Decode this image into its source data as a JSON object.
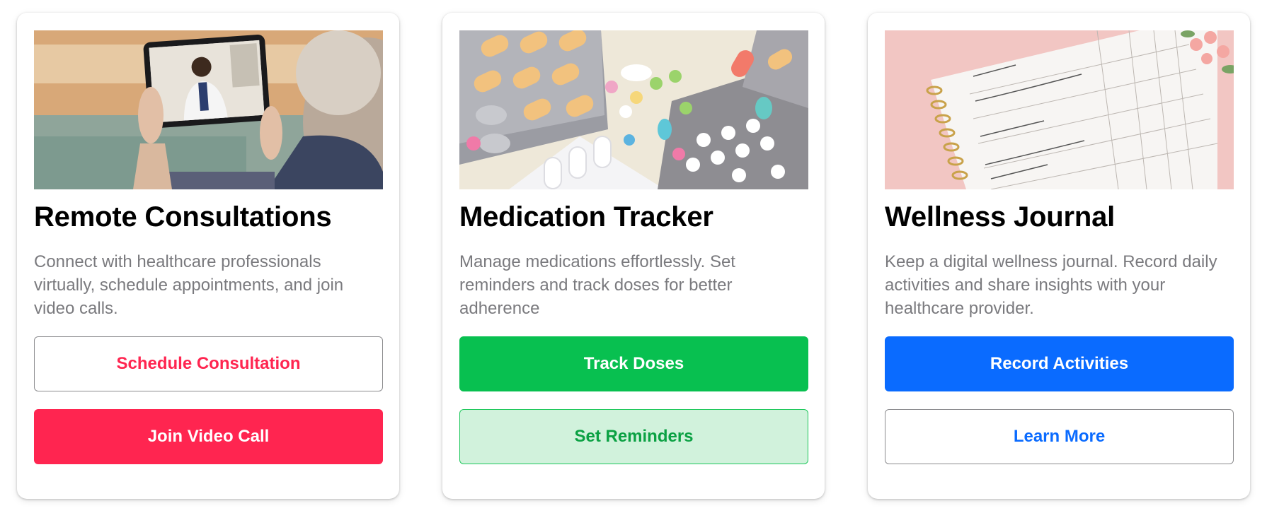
{
  "cards": [
    {
      "title": "Remote Consultations",
      "description": "Connect with healthcare professionals virtually, schedule appointments, and join video calls.",
      "primary_button": "Schedule Consultation",
      "secondary_button": "Join Video Call",
      "image": "telehealth-tablet-video-call-photo",
      "accent": "#ff2550"
    },
    {
      "title": "Medication Tracker",
      "description": "Manage medications effortlessly. Set reminders and track doses for better adherence",
      "primary_button": "Track Doses",
      "secondary_button": "Set Reminders",
      "image": "pills-and-blister-packs-photo",
      "accent": "#08c050"
    },
    {
      "title": "Wellness Journal",
      "description": "Keep a digital wellness journal. Record daily activities and share insights with your healthcare provider.",
      "primary_button": "Record Activities",
      "secondary_button": "Learn More",
      "image": "wellness-planner-notebook-photo",
      "accent": "#0a6bff"
    }
  ]
}
